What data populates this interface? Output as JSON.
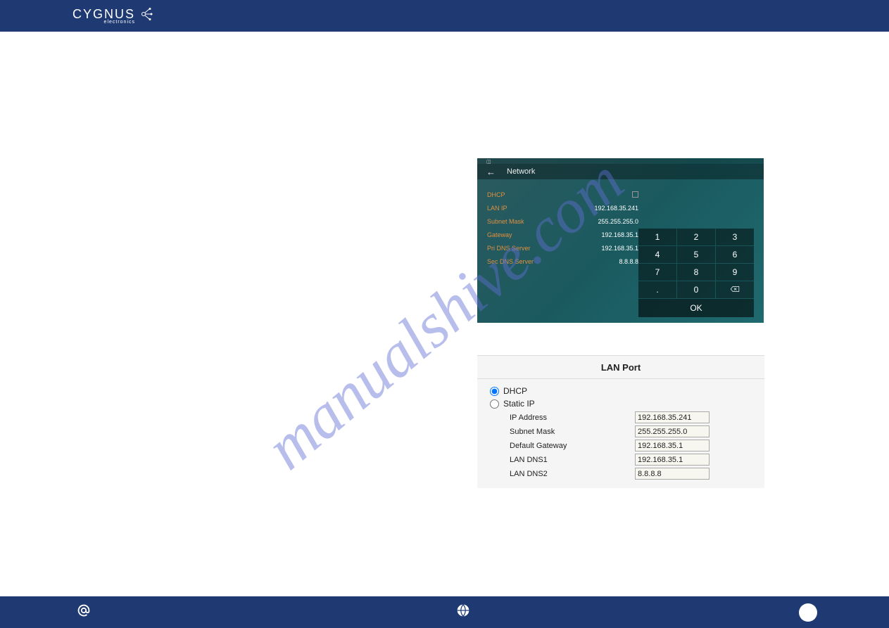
{
  "header": {
    "logo_text": "CYGNUS",
    "logo_sub": "electronics"
  },
  "watermark": "manualshive.com",
  "network_panel": {
    "title": "Network",
    "rows": {
      "dhcp_label": "DHCP",
      "lanip_label": "LAN IP",
      "lanip_value": "192.168.35.241",
      "subnet_label": "Subnet Mask",
      "subnet_value": "255.255.255.0",
      "gateway_label": "Gateway",
      "gateway_value": "192.168.35.1",
      "pridns_label": "Pri DNS Server",
      "pridns_value": "192.168.35.1",
      "secdns_label": "Sec DNS Server",
      "secdns_value": "8.8.8.8"
    },
    "keypad": {
      "k1": "1",
      "k2": "2",
      "k3": "3",
      "k4": "4",
      "k5": "5",
      "k6": "6",
      "k7": "7",
      "k8": "8",
      "k9": "9",
      "kdot": ".",
      "k0": "0",
      "ok": "OK"
    }
  },
  "lan_panel": {
    "title": "LAN Port",
    "radio_dhcp": "DHCP",
    "radio_static": "Static IP",
    "fields": {
      "ip_label": "IP Address",
      "ip_value": "192.168.35.241",
      "sm_label": "Subnet Mask",
      "sm_value": "255.255.255.0",
      "gw_label": "Default Gateway",
      "gw_value": "192.168.35.1",
      "d1_label": "LAN DNS1",
      "d1_value": "192.168.35.1",
      "d2_label": "LAN DNS2",
      "d2_value": "8.8.8.8"
    }
  }
}
